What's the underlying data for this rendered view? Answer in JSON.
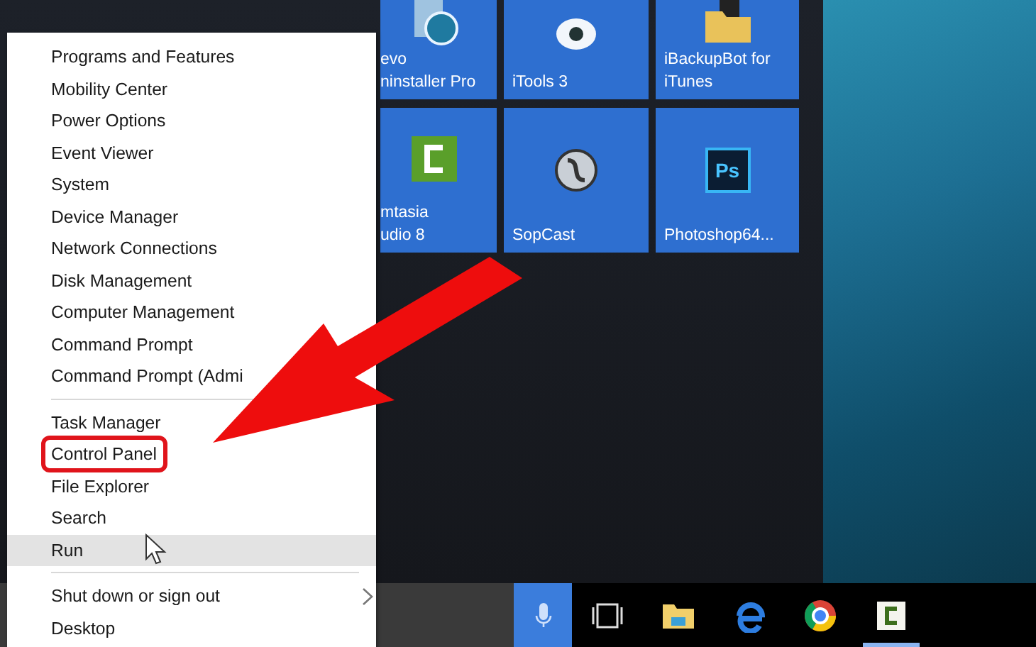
{
  "tiles": [
    {
      "kind": "revo",
      "label_lines": [
        "evo",
        "ninstaller Pro"
      ]
    },
    {
      "kind": "itools",
      "label_lines": [
        "iTools 3"
      ]
    },
    {
      "kind": "backup",
      "label_lines": [
        "iBackupBot for",
        "iTunes"
      ]
    },
    {
      "kind": "camtasia",
      "label_lines": [
        "mtasia",
        "udio 8"
      ]
    },
    {
      "kind": "sopcast",
      "label_lines": [
        "SopCast"
      ]
    },
    {
      "kind": "photoshop",
      "icon_text": "Ps",
      "label_lines": [
        "Photoshop64..."
      ]
    }
  ],
  "context_menu": {
    "groups": [
      [
        {
          "label": "Programs and Features",
          "selected": false,
          "circled": false,
          "submenu": false
        },
        {
          "label": "Mobility Center",
          "selected": false,
          "circled": false,
          "submenu": false
        },
        {
          "label": "Power Options",
          "selected": false,
          "circled": false,
          "submenu": false
        },
        {
          "label": "Event Viewer",
          "selected": false,
          "circled": false,
          "submenu": false
        },
        {
          "label": "System",
          "selected": false,
          "circled": false,
          "submenu": false
        },
        {
          "label": "Device Manager",
          "selected": false,
          "circled": false,
          "submenu": false
        },
        {
          "label": "Network Connections",
          "selected": false,
          "circled": false,
          "submenu": false
        },
        {
          "label": "Disk Management",
          "selected": false,
          "circled": false,
          "submenu": false
        },
        {
          "label": "Computer Management",
          "selected": false,
          "circled": false,
          "submenu": false
        },
        {
          "label": "Command Prompt",
          "selected": false,
          "circled": false,
          "submenu": false
        },
        {
          "label": "Command Prompt (Admi",
          "selected": false,
          "circled": false,
          "submenu": false
        }
      ],
      [
        {
          "label": "Task Manager",
          "selected": false,
          "circled": false,
          "submenu": false
        },
        {
          "label": "Control Panel",
          "selected": false,
          "circled": true,
          "submenu": false
        },
        {
          "label": "File Explorer",
          "selected": false,
          "circled": false,
          "submenu": false
        },
        {
          "label": "Search",
          "selected": false,
          "circled": false,
          "submenu": false
        },
        {
          "label": "Run",
          "selected": true,
          "circled": false,
          "submenu": false
        }
      ],
      [
        {
          "label": "Shut down or sign out",
          "selected": false,
          "circled": false,
          "submenu": true
        },
        {
          "label": "Desktop",
          "selected": false,
          "circled": false,
          "submenu": false
        }
      ]
    ]
  },
  "taskbar": [
    {
      "kind": "mic",
      "running": false
    },
    {
      "kind": "taskview",
      "running": false
    },
    {
      "kind": "folder",
      "running": false
    },
    {
      "kind": "edge",
      "running": false
    },
    {
      "kind": "chrome",
      "running": false
    },
    {
      "kind": "camtasia",
      "running": true
    }
  ]
}
